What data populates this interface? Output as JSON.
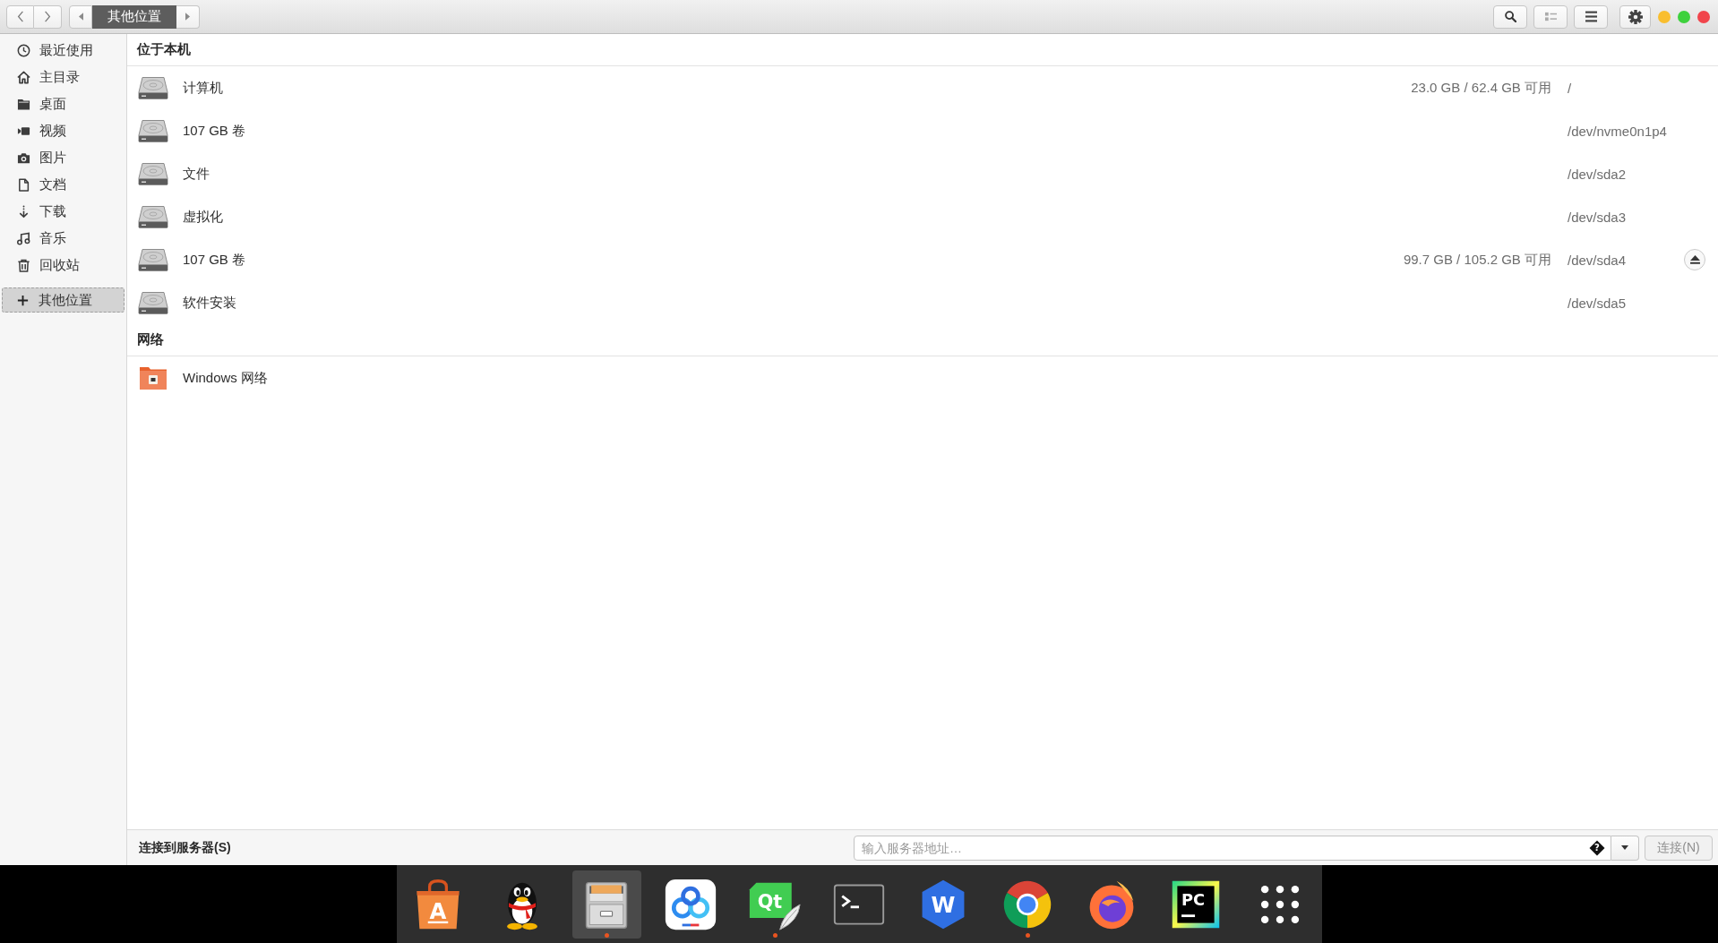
{
  "pathbar": {
    "segments": [
      {
        "label": "其他位置",
        "selected": true
      }
    ]
  },
  "sidebar": {
    "groups": [
      {
        "items": [
          {
            "kind": "recent",
            "label": "最近使用",
            "selected": false
          },
          {
            "kind": "home",
            "label": "主目录",
            "selected": false
          },
          {
            "kind": "desktop",
            "label": "桌面",
            "selected": false
          },
          {
            "kind": "videos",
            "label": "视频",
            "selected": false
          },
          {
            "kind": "pictures",
            "label": "图片",
            "selected": false
          },
          {
            "kind": "documents",
            "label": "文档",
            "selected": false
          },
          {
            "kind": "downloads",
            "label": "下载",
            "selected": false
          },
          {
            "kind": "music",
            "label": "音乐",
            "selected": false
          },
          {
            "kind": "trash",
            "label": "回收站",
            "selected": false
          }
        ]
      },
      {
        "items": [
          {
            "kind": "other",
            "label": "其他位置",
            "selected": true
          }
        ]
      }
    ]
  },
  "sections": [
    {
      "title": "位于本机",
      "items": [
        {
          "kind": "drive",
          "name": "计算机",
          "free": "23.0 GB / 62.4 GB 可用",
          "device": "/",
          "ejectable": false
        },
        {
          "kind": "drive",
          "name": "107 GB 卷",
          "device": "/dev/nvme0n1p4",
          "ejectable": false
        },
        {
          "kind": "drive",
          "name": "文件",
          "device": "/dev/sda2",
          "ejectable": false
        },
        {
          "kind": "drive",
          "name": "虚拟化",
          "device": "/dev/sda3",
          "ejectable": false
        },
        {
          "kind": "drive",
          "name": "107 GB 卷",
          "free": "99.7 GB / 105.2 GB 可用",
          "device": "/dev/sda4",
          "ejectable": true
        },
        {
          "kind": "drive",
          "name": "软件安装",
          "device": "/dev/sda5",
          "ejectable": false
        }
      ]
    },
    {
      "title": "网络",
      "items": [
        {
          "kind": "network",
          "name": "Windows 网络",
          "ejectable": false
        }
      ]
    }
  ],
  "connect_bar": {
    "label": "连接到服务器(S)",
    "placeholder": "输入服务器地址…",
    "help_glyph": "?",
    "button": {
      "label": "连接(N)",
      "disabled": true
    }
  },
  "dock": {
    "items": [
      {
        "kind": "software",
        "logo_text": "A",
        "running": false,
        "focused": false
      },
      {
        "kind": "qq",
        "running": false,
        "focused": false
      },
      {
        "kind": "files",
        "running": true,
        "focused": true
      },
      {
        "kind": "netdisk",
        "running": false,
        "focused": false
      },
      {
        "kind": "qt",
        "logo_text": "Qt",
        "running": true,
        "focused": false
      },
      {
        "kind": "terminal",
        "running": false,
        "focused": false
      },
      {
        "kind": "wps",
        "logo_text": "W",
        "running": false,
        "focused": false
      },
      {
        "kind": "chrome",
        "running": true,
        "focused": false
      },
      {
        "kind": "firefox",
        "running": false,
        "focused": false
      },
      {
        "kind": "pycharm",
        "logo_text": "PC",
        "running": false,
        "focused": false
      },
      {
        "kind": "apps",
        "running": false,
        "focused": false
      }
    ]
  }
}
